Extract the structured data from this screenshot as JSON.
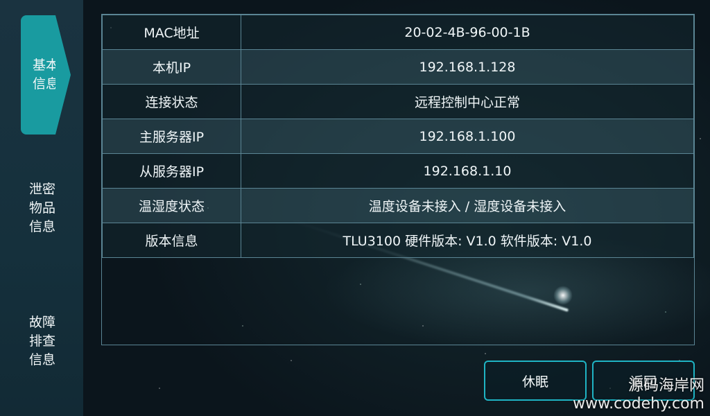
{
  "sidebar": {
    "items": [
      {
        "label": "基本\n信息",
        "active": true
      },
      {
        "label": "泄密\n物品\n信息",
        "active": false
      },
      {
        "label": "故障\n排查\n信息",
        "active": false
      }
    ]
  },
  "info": {
    "rows": [
      {
        "label": "MAC地址",
        "value": "20-02-4B-96-00-1B"
      },
      {
        "label": "本机IP",
        "value": "192.168.1.128"
      },
      {
        "label": "连接状态",
        "value": "远程控制中心正常"
      },
      {
        "label": "主服务器IP",
        "value": "192.168.1.100"
      },
      {
        "label": "从服务器IP",
        "value": "192.168.1.10"
      },
      {
        "label": "温湿度状态",
        "value": "温度设备未接入 / 湿度设备未接入"
      },
      {
        "label": "版本信息",
        "value": "TLU3100  硬件版本: V1.0  软件版本: V1.0"
      }
    ]
  },
  "buttons": {
    "sleep": "休眠",
    "back": "返回"
  },
  "watermark": {
    "line1": "源码海岸网",
    "line2": "www.codehy.com"
  },
  "colors": {
    "accent": "#199ba0",
    "border": "#5b8594",
    "button_border": "#1fb4c4"
  }
}
